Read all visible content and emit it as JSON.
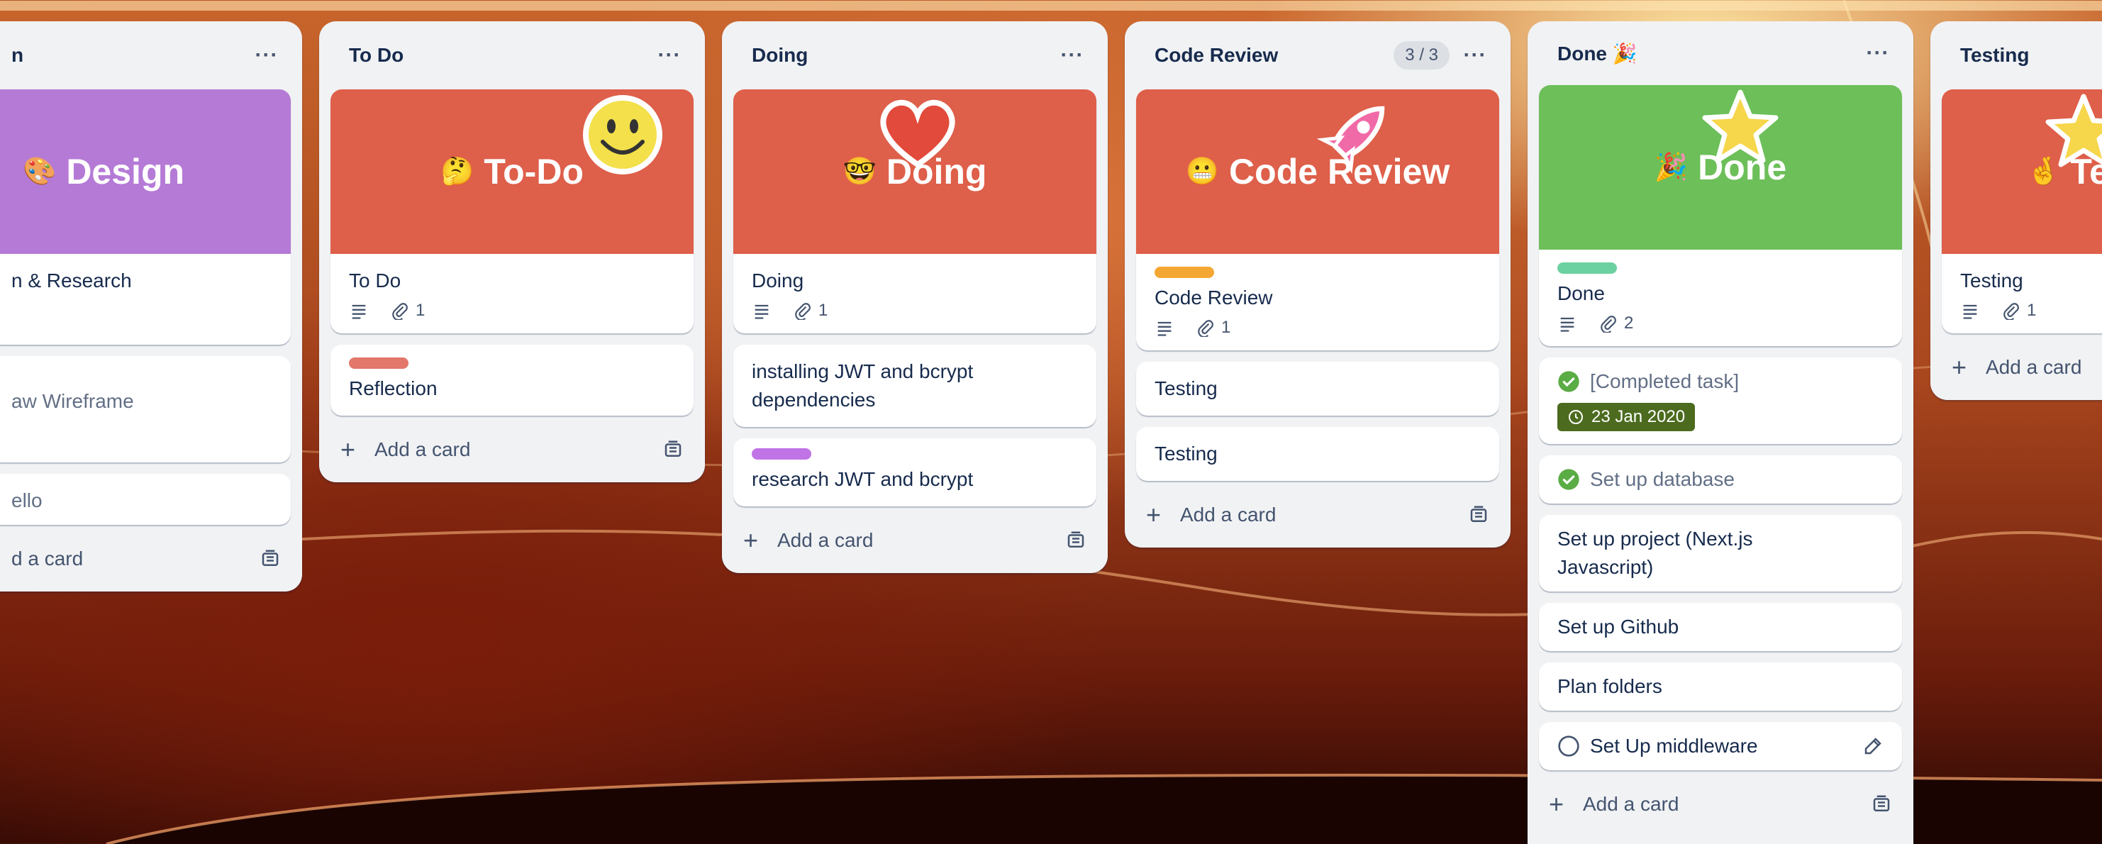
{
  "colors": {
    "purple_cover": "#b57ad6",
    "red_cover": "#de5f4a",
    "green_cover": "#6cbf59",
    "done_check": "#5aac44",
    "date_badge": "#4c6b1f"
  },
  "lists": {
    "design": {
      "title": "n",
      "cover_text": "Design",
      "cover_emoji": "🎨",
      "cards": [
        "n & Research",
        "aw Wireframe",
        "ello"
      ],
      "add_card": "d a card"
    },
    "todo": {
      "title": "To Do",
      "cover_text": "To-Do",
      "cover_emoji": "🤔",
      "cover_card_title": "To Do",
      "attachments": "1",
      "card2": "Reflection",
      "add_card": "Add a card"
    },
    "doing": {
      "title": "Doing",
      "cover_text": "Doing",
      "cover_emoji": "🤓",
      "cover_card_title": "Doing",
      "attachments": "1",
      "card2": "installing JWT and bcrypt dependencies",
      "card3": "research JWT and bcrypt",
      "add_card": "Add a card"
    },
    "code_review": {
      "title": "Code Review",
      "count": "3 / 3",
      "cover_text": "Code Review",
      "cover_emoji": "😬",
      "cover_card_title": "Code Review",
      "attachments": "1",
      "card2": "Testing",
      "card3": "Testing",
      "add_card": "Add a card"
    },
    "done": {
      "title": "Done 🎉",
      "cover_text": "Done",
      "cover_emoji": "🎉",
      "cover_card_title": "Done",
      "attachments": "2",
      "completed_task": "[Completed task]",
      "date": "23 Jan 2020",
      "setup_db": "Set up database",
      "setup_project": "Set up project (Next.js Javascript)",
      "setup_github": "Set up Github",
      "plan_folders": "Plan folders",
      "setup_middleware": "Set Up middleware",
      "add_card": "Add a card"
    },
    "testing": {
      "title": "Testing",
      "cover_text": "Te",
      "cover_emoji": "🤞",
      "cover_card_title": "Testing",
      "attachments": "1",
      "add_card": "Add a card"
    }
  },
  "menu_dots": "···",
  "icons": [
    "description-icon",
    "paperclip-icon",
    "plus-icon",
    "template-icon",
    "check-circle-icon",
    "clock-icon",
    "circle-icon",
    "edit-icon"
  ]
}
